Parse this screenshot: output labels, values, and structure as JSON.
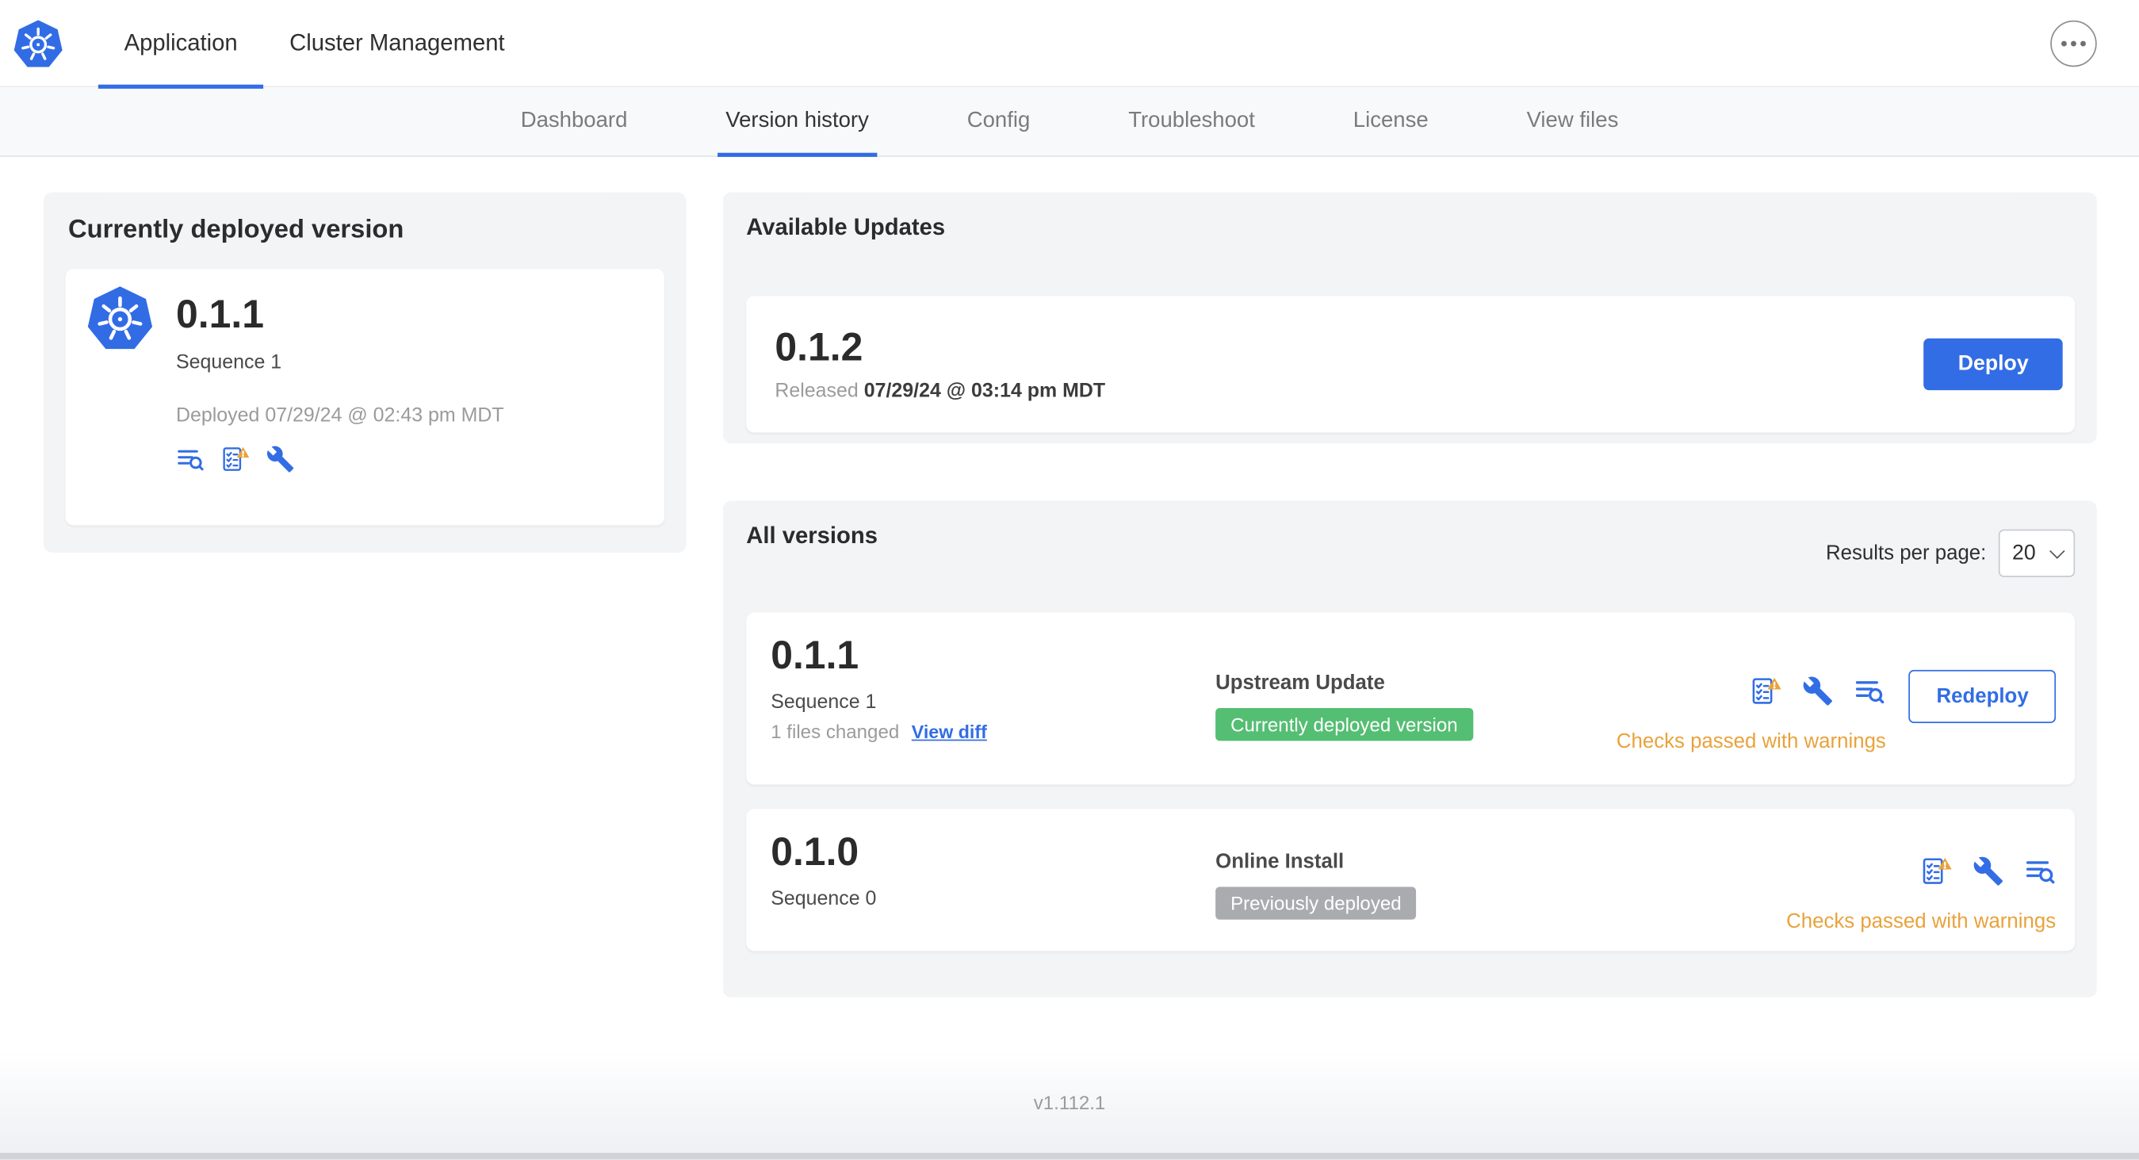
{
  "colors": {
    "accent": "#326DE5",
    "green-badge": "#54BE73",
    "gray-badge": "#A9ABAE",
    "warning": "#E9A23B"
  },
  "topnav": {
    "tabs": [
      {
        "label": "Application"
      },
      {
        "label": "Cluster Management"
      }
    ]
  },
  "subnav": {
    "active": "Version history",
    "tabs": [
      {
        "label": "Dashboard"
      },
      {
        "label": "Version history"
      },
      {
        "label": "Config"
      },
      {
        "label": "Troubleshoot"
      },
      {
        "label": "License"
      },
      {
        "label": "View files"
      }
    ]
  },
  "current_version": {
    "title": "Currently deployed version",
    "version": "0.1.1",
    "sequence": "Sequence 1",
    "deployed_at": "Deployed 07/29/24 @ 02:43 pm MDT"
  },
  "available_updates": {
    "title": "Available Updates",
    "version": "0.1.2",
    "released_label": "Released",
    "released_at": "07/29/24 @ 03:14 pm MDT",
    "deploy_button": "Deploy"
  },
  "all_versions": {
    "title": "All versions",
    "results_per_page_label": "Results per page:",
    "results_per_page_value": "20",
    "rows": [
      {
        "version": "0.1.1",
        "sequence": "Sequence 1",
        "files_changed": "1 files changed",
        "view_diff_link": "View diff",
        "source": "Upstream Update",
        "badge": "Currently deployed version",
        "status": "Checks passed with warnings",
        "action_button": "Redeploy"
      },
      {
        "version": "0.1.0",
        "sequence": "Sequence 0",
        "source": "Online Install",
        "badge": "Previously deployed",
        "status": "Checks passed with warnings"
      }
    ]
  },
  "footer": {
    "app_version": "v1.112.1"
  },
  "icons": {
    "logo": "kubernetes-logo",
    "overflow": "ellipsis-icon",
    "logs": "logs-search-icon",
    "preflight": "preflight-checklist-warning-icon",
    "config": "config-wrench-icon",
    "select_caret": "chevron-down-icon"
  }
}
